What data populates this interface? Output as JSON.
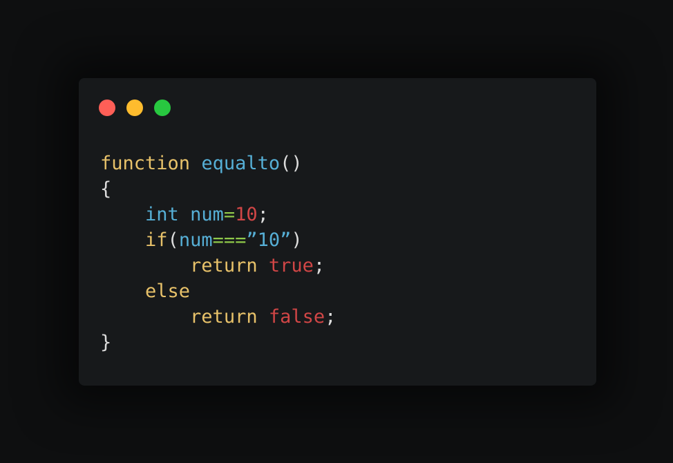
{
  "window": {
    "controls": {
      "close_color": "#ff5f57",
      "minimize_color": "#febc2e",
      "maximize_color": "#28c840"
    }
  },
  "code": {
    "lines": [
      [
        {
          "t": "function",
          "k": "kw"
        },
        {
          "t": " ",
          "k": "punc"
        },
        {
          "t": "equalto",
          "k": "fn"
        },
        {
          "t": "()",
          "k": "punc"
        }
      ],
      [
        {
          "t": "{",
          "k": "punc"
        }
      ],
      [
        {
          "t": "    ",
          "k": "punc"
        },
        {
          "t": "int",
          "k": "type"
        },
        {
          "t": " ",
          "k": "punc"
        },
        {
          "t": "num",
          "k": "var"
        },
        {
          "t": "=",
          "k": "op"
        },
        {
          "t": "10",
          "k": "num"
        },
        {
          "t": ";",
          "k": "punc"
        }
      ],
      [
        {
          "t": "    ",
          "k": "punc"
        },
        {
          "t": "if",
          "k": "kw"
        },
        {
          "t": "(",
          "k": "punc"
        },
        {
          "t": "num",
          "k": "var"
        },
        {
          "t": "===",
          "k": "op"
        },
        {
          "t": "”10”",
          "k": "str"
        },
        {
          "t": ")",
          "k": "punc"
        }
      ],
      [
        {
          "t": "        ",
          "k": "punc"
        },
        {
          "t": "return",
          "k": "kw"
        },
        {
          "t": " ",
          "k": "punc"
        },
        {
          "t": "true",
          "k": "bool"
        },
        {
          "t": ";",
          "k": "punc"
        }
      ],
      [
        {
          "t": "    ",
          "k": "punc"
        },
        {
          "t": "else",
          "k": "kw"
        }
      ],
      [
        {
          "t": "        ",
          "k": "punc"
        },
        {
          "t": "return",
          "k": "kw"
        },
        {
          "t": " ",
          "k": "punc"
        },
        {
          "t": "false",
          "k": "bool"
        },
        {
          "t": ";",
          "k": "punc"
        }
      ],
      [
        {
          "t": "}",
          "k": "punc"
        }
      ]
    ]
  }
}
